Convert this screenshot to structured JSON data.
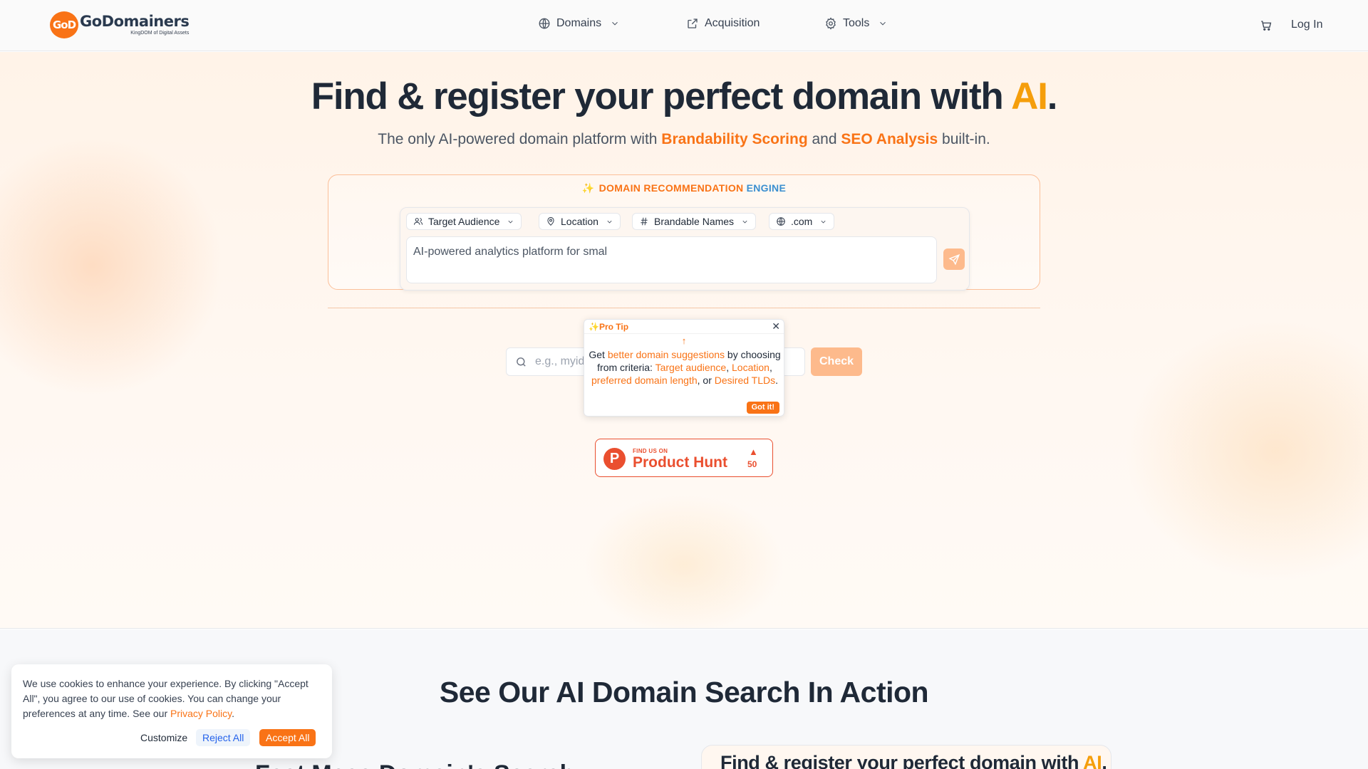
{
  "brand": {
    "logo_badge": "GoD",
    "name": "GoDomainers",
    "tagline": "KingDOM of Digital Assets",
    "accent_color": "#f97316"
  },
  "nav": {
    "items": [
      {
        "label": "Domains",
        "icon": "globe-icon",
        "has_dropdown": true
      },
      {
        "label": "Acquisition",
        "icon": "external-link-icon",
        "has_dropdown": false
      },
      {
        "label": "Tools",
        "icon": "gear-icon",
        "has_dropdown": true
      }
    ],
    "cart_icon": "cart-icon",
    "login_label": "Log In"
  },
  "hero": {
    "title_main": "Find & register your perfect domain with ",
    "title_ai": "AI",
    "title_end": ".",
    "subtitle_pre": "The only AI-powered domain platform with ",
    "subtitle_hl1": "Brandability Scoring",
    "subtitle_mid": " and ",
    "subtitle_hl2": "SEO Analysis",
    "subtitle_post": " built-in."
  },
  "engine": {
    "label_part1": "DOMAIN RECOMMENDATION",
    "label_part2": "ENGINE",
    "chips": [
      {
        "label": "Target Audience",
        "icon": "users-icon"
      },
      {
        "label": "Location",
        "icon": "map-pin-icon"
      },
      {
        "label": "Brandable Names",
        "icon": "hash-icon"
      },
      {
        "label": ".com",
        "icon": "globe-icon"
      }
    ],
    "query_value": "AI-powered analytics platform for smal"
  },
  "domain_check": {
    "placeholder": "e.g., myidea.com",
    "button_label": "Check"
  },
  "pro_tip": {
    "title": "✨Pro Tip",
    "t1": "Get ",
    "h1": "better domain suggestions",
    "t2": " by choosing from criteria: ",
    "h2": "Target audience",
    "t3": ", ",
    "h3": "Location",
    "t4": ", ",
    "h4": "preferred domain length",
    "t5": ", or ",
    "h5": "Desired TLDs",
    "t6": ".",
    "button_label": "Got it!"
  },
  "product_hunt": {
    "small": "FIND US ON",
    "big": "Product Hunt",
    "count": "50"
  },
  "lower": {
    "title": "See Our AI Domain Search In Action",
    "left_heading": "Fast Mass Domain's Search",
    "preview_main": "Find & register your perfect domain with ",
    "preview_ai": "AI",
    "preview_end": "."
  },
  "cookie": {
    "text": "We use cookies to enhance your experience. By clicking \"Accept All\", you agree to our use of cookies. You can change your preferences at any time. See our ",
    "policy_link": "Privacy Policy",
    "text_end": ".",
    "customize_label": "Customize",
    "reject_label": "Reject All",
    "accept_label": "Accept All"
  }
}
